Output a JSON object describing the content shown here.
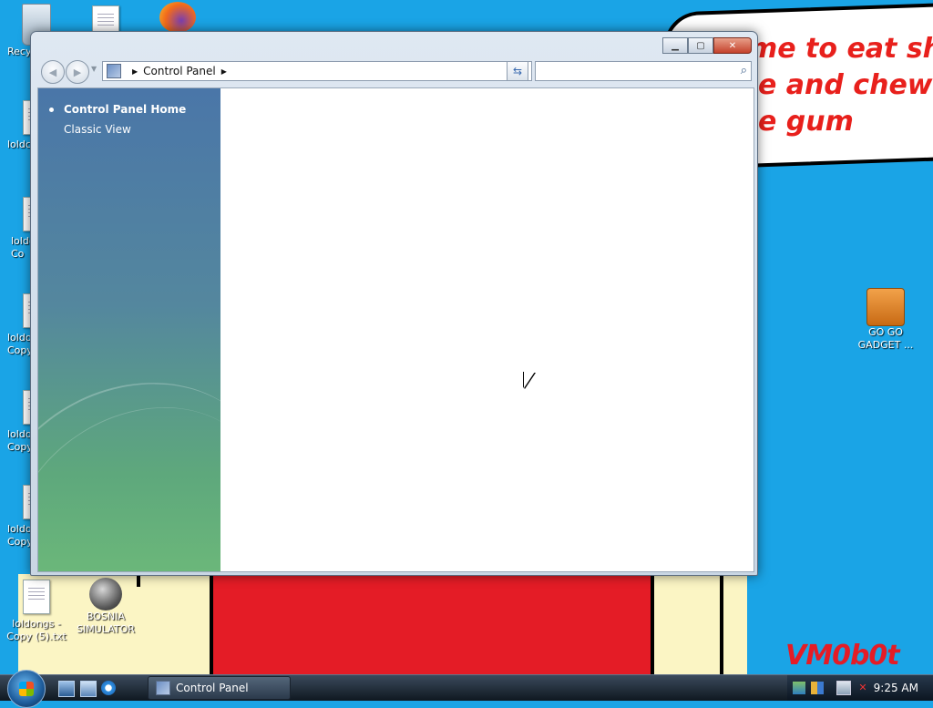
{
  "desktop": {
    "wallpaper_text": [
      "me to eat shit",
      "e and chew",
      "e gum"
    ],
    "signature": "VM0b0t",
    "icons": [
      {
        "label": "Recy",
        "icon": "recycle-bin-icon"
      },
      {
        "label": "loldc",
        "icon": "text-file-icon"
      },
      {
        "label": "loldo Co",
        "icon": "text-file-icon"
      },
      {
        "label": "loldo Copy",
        "icon": "text-file-icon"
      },
      {
        "label": "loldo Copy",
        "icon": "text-file-icon"
      },
      {
        "label": "loldo Copy",
        "icon": "text-file-icon"
      },
      {
        "label": "loldongs - Copy (5).txt",
        "icon": "text-file-icon"
      },
      {
        "label": "BOSNIA SIMULATOR",
        "icon": "mine-shortcut-icon"
      },
      {
        "label": "GO GO GADGET ...",
        "icon": "briefcase-icon"
      }
    ]
  },
  "window": {
    "title": "",
    "address_path": "Control Panel",
    "search_placeholder": "",
    "sidebar": {
      "items": [
        {
          "label": "Control Panel Home",
          "active": true
        },
        {
          "label": "Classic View",
          "active": false
        }
      ]
    }
  },
  "taskbar": {
    "task_label": "Control Panel",
    "clock": "9:25 AM"
  },
  "colors": {
    "desktop_bg": "#1aa4e6",
    "wallpaper_red": "#e41c26",
    "wallpaper_yellow": "#fbf5c4"
  }
}
